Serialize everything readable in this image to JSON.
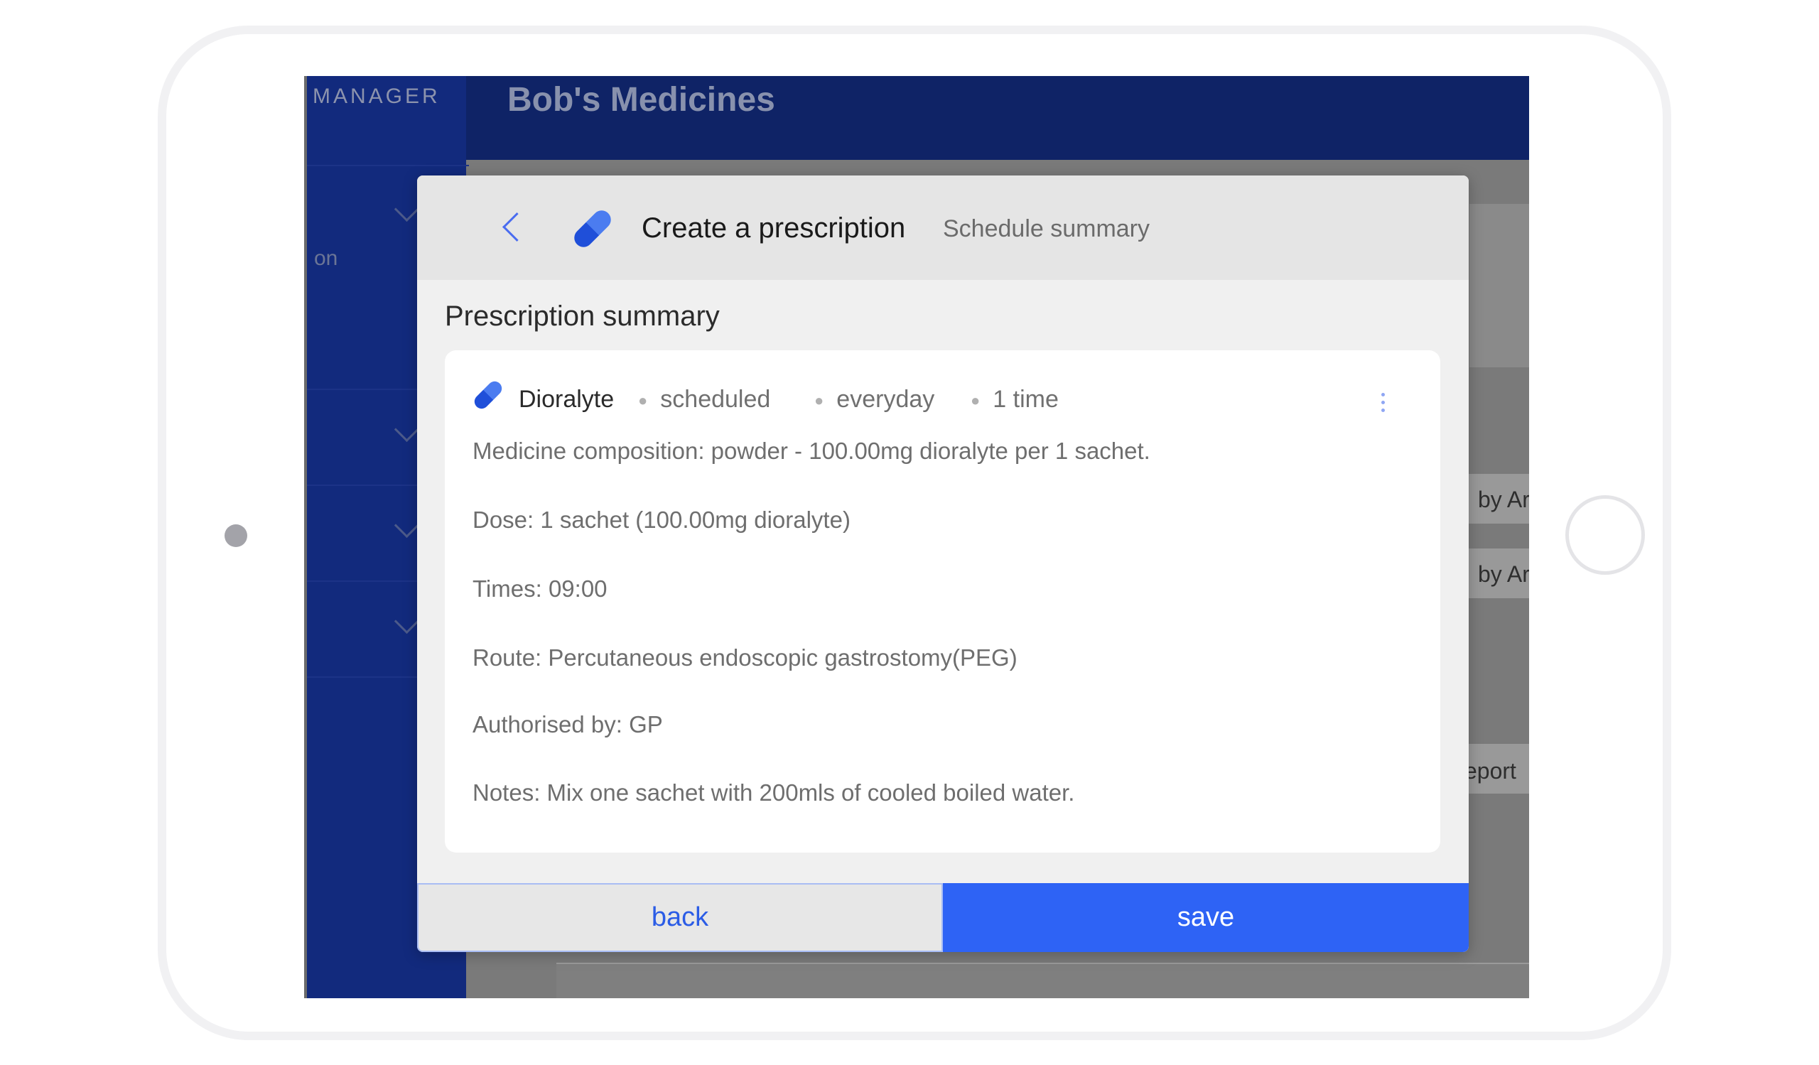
{
  "app": {
    "brand": "MANAGER",
    "title": "Bob's Medicines",
    "sidebar_partial_text": "on"
  },
  "background": {
    "partial_texts": [
      "by Ar",
      "by Ar",
      "eport"
    ]
  },
  "modal": {
    "title": "Create a prescription",
    "subtitle": "Schedule summary",
    "section_title": "Prescription summary",
    "medicine": {
      "name": "Dioralyte",
      "tags": [
        "scheduled",
        "everyday",
        "1 time"
      ],
      "details": {
        "composition": "Medicine composition: powder - 100.00mg dioralyte per 1 sachet.",
        "dose": "Dose: 1 sachet (100.00mg dioralyte)",
        "times": "Times: 09:00",
        "route": "Route: Percutaneous endoscopic gastrostomy(PEG)",
        "authorised": "Authorised by: GP",
        "notes": "Notes: Mix one sachet with 200mls of cooled boiled water."
      }
    },
    "buttons": {
      "back": "back",
      "save": "save"
    }
  },
  "colors": {
    "accent": "#2e63f5",
    "sidebar": "#122a7d",
    "header": "#0f2366",
    "pill_light": "#4b7cf0",
    "pill_dark": "#1f4fd9"
  },
  "icons": [
    "chevron-left-icon",
    "pill-icon",
    "more-vertical-icon",
    "chevron-down-icon"
  ]
}
